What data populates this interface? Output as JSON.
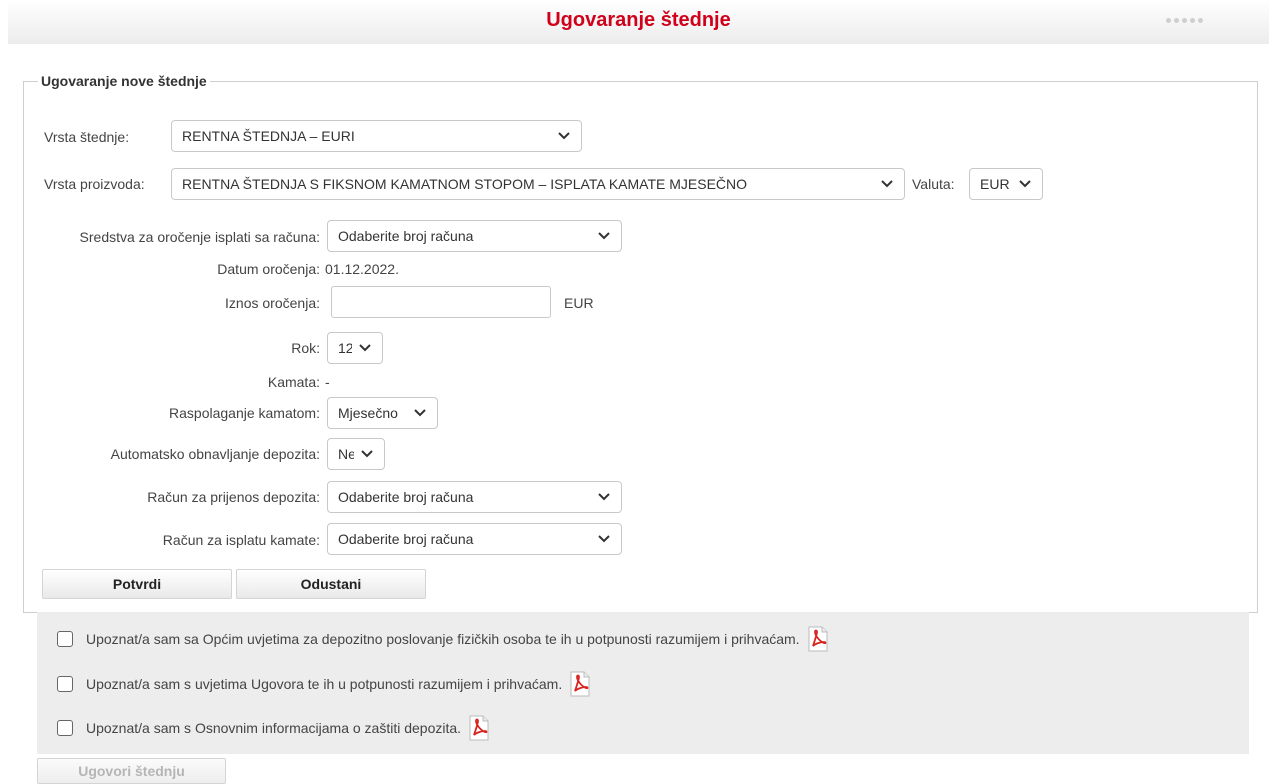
{
  "header": {
    "title": "Ugovaranje štednje"
  },
  "form": {
    "legend": "Ugovaranje nove štednje",
    "savings_type": {
      "label": "Vrsta štednje:",
      "value": "RENTNA ŠTEDNJA – EURI"
    },
    "product_type": {
      "label": "Vrsta proizvoda:",
      "value": "RENTNA ŠTEDNJA S FIKSNOM KAMATNOM STOPOM – ISPLATA KAMATE MJESEČNO"
    },
    "currency": {
      "label": "Valuta:",
      "value": "EUR"
    },
    "source_account": {
      "label": "Sredstva za oročenje isplati sa računa:",
      "value": "Odaberite broj računa"
    },
    "deposit_date": {
      "label": "Datum oročenja:",
      "value": "01.12.2022."
    },
    "amount": {
      "label": "Iznos oročenja:",
      "value": "",
      "unit": "EUR"
    },
    "term": {
      "label": "Rok:",
      "value": "12"
    },
    "interest": {
      "label": "Kamata:",
      "value": "-"
    },
    "interest_disposal": {
      "label": "Raspolaganje kamatom:",
      "value": "Mjesečno"
    },
    "auto_renewal": {
      "label": "Automatsko obnavljanje depozita:",
      "value": "Ne"
    },
    "transfer_account": {
      "label": "Račun za prijenos depozita:",
      "value": "Odaberite broj računa"
    },
    "interest_account": {
      "label": "Račun za isplatu kamate:",
      "value": "Odaberite broj računa"
    },
    "confirm_label": "Potvrdi",
    "cancel_label": "Odustani"
  },
  "terms": [
    {
      "text": "Upoznat/a sam sa Općim uvjetima za depozitno poslovanje fizičkih osoba te ih u potpunosti razumijem i prihvaćam.",
      "checked": false,
      "icon": "pdf-icon"
    },
    {
      "text": "Upoznat/a sam s uvjetima Ugovora te ih u potpunosti razumijem i prihvaćam.",
      "checked": false,
      "icon": "pdf-icon"
    },
    {
      "text": "Upoznat/a sam s Osnovnim informacijama o zaštiti depozita.",
      "checked": false,
      "icon": "pdf-icon"
    }
  ],
  "submit_label": "Ugovori štednju",
  "colors": {
    "title": "#d0021b",
    "terms_bg": "#ededed"
  }
}
